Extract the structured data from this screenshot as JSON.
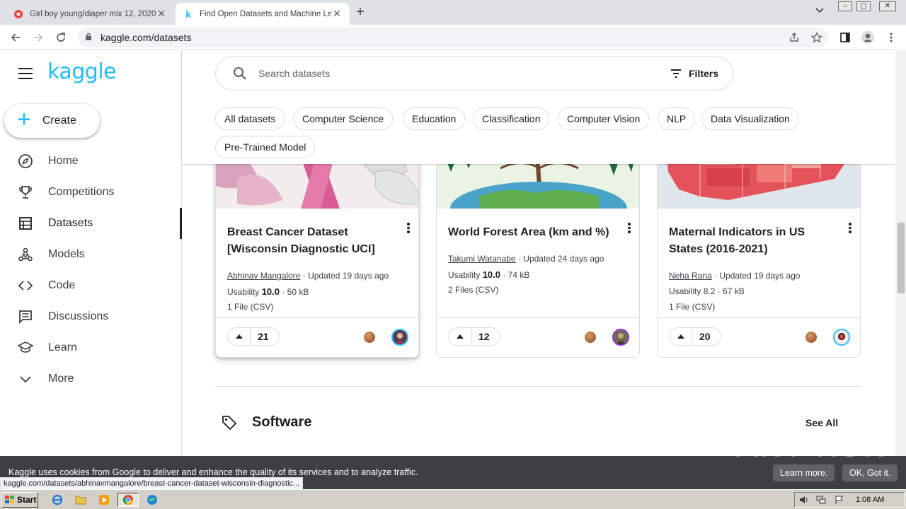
{
  "browser": {
    "tabs": [
      {
        "title": "Girl boy young/diaper mix 12, 2020(",
        "active": false
      },
      {
        "title": "Find Open Datasets and Machine Le",
        "active": true
      }
    ],
    "url": "kaggle.com/datasets",
    "new_tab": "+",
    "tab_menu": "⌄",
    "window_buttons": {
      "minimize": "–",
      "maximize": "▢",
      "close": "✕"
    }
  },
  "sidebar": {
    "logo": "kaggle",
    "create_label": "Create",
    "items": [
      {
        "label": "Home",
        "icon": "compass-icon"
      },
      {
        "label": "Competitions",
        "icon": "trophy-icon"
      },
      {
        "label": "Datasets",
        "icon": "table-icon",
        "active": true
      },
      {
        "label": "Models",
        "icon": "models-icon"
      },
      {
        "label": "Code",
        "icon": "code-icon"
      },
      {
        "label": "Discussions",
        "icon": "discussions-icon"
      },
      {
        "label": "Learn",
        "icon": "school-icon"
      },
      {
        "label": "More",
        "icon": "chevron-down-icon"
      }
    ]
  },
  "search": {
    "placeholder": "Search datasets",
    "filters_label": "Filters"
  },
  "chips": [
    "All datasets",
    "Computer Science",
    "Education",
    "Classification",
    "Computer Vision",
    "NLP",
    "Data Visualization",
    "Pre-Trained Model"
  ],
  "cards": [
    {
      "title": "Breast Cancer Dataset [Wisconsin Diagnostic UCI]",
      "author": "Abhinav Mangalore",
      "updated": " · Updated 19 days ago",
      "usability_label": "Usability ",
      "usability": "10.0",
      "size": " · 50 kB",
      "files": "1 File (CSV)",
      "votes": "21"
    },
    {
      "title": "World Forest Area (km and %)",
      "author": "Takumi Watanabe",
      "updated": " · Updated 24 days ago",
      "usability_label": "Usability ",
      "usability": "10.0",
      "size": " · 74 kB",
      "files": "2 Files (CSV)",
      "votes": "12"
    },
    {
      "title": "Maternal Indicators in US States (2016-2021)",
      "author": "Neha Rana",
      "updated": " · Updated 19 days ago",
      "usability_label": "Usability ",
      "usability": "8.2",
      "size": " · 67 kB",
      "files": "1 File (CSV)",
      "votes": "20"
    }
  ],
  "section": {
    "title": "Software",
    "see_all": "See All"
  },
  "cookie": {
    "text": "Kaggle uses cookies from Google to deliver and enhance the quality of its services and to analyze traffic.",
    "learn_more": "Learn more.",
    "ok": "OK, Got it."
  },
  "status_url": "kaggle.com/datasets/abhinavmangalore/breast-cancer-dataset-wisconsin-diagnostic...",
  "watermark": "ANY RUN",
  "taskbar": {
    "start": "Start",
    "clock": "1:08 AM"
  },
  "colors": {
    "accent": "#20beff",
    "text": "#202124",
    "border": "#dadce0"
  }
}
